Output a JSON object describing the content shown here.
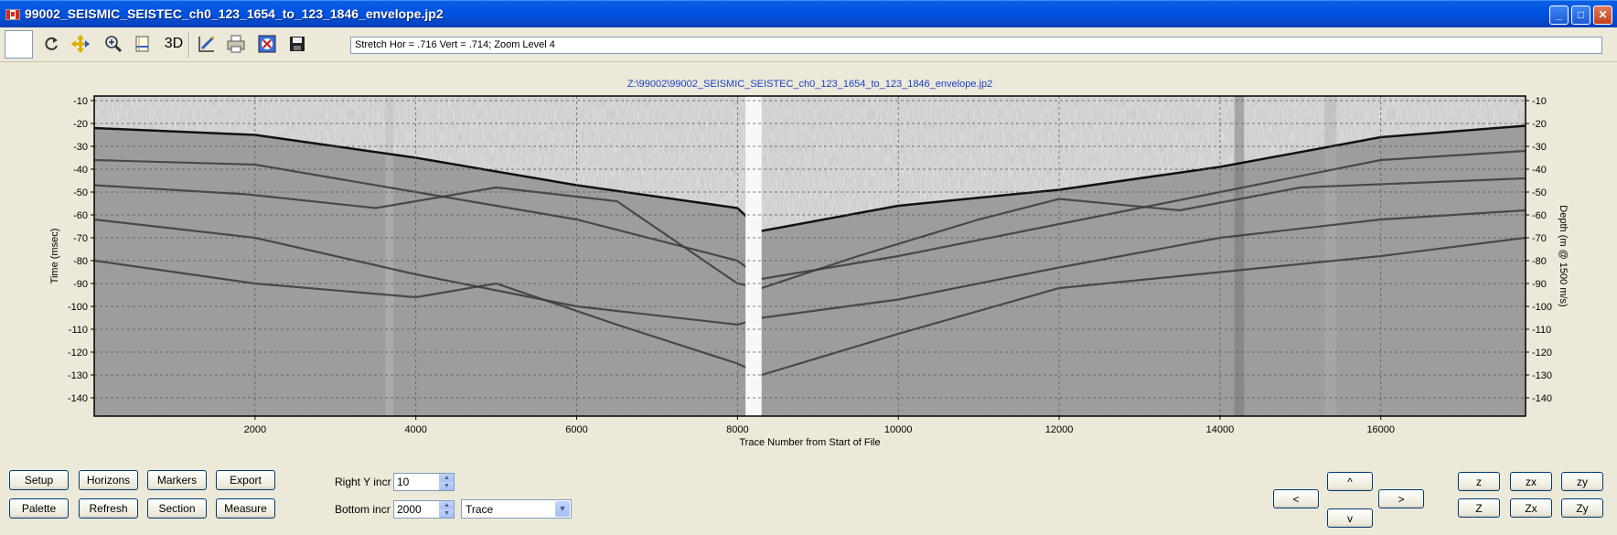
{
  "window": {
    "title": "99002_SEISMIC_SEISTEC_ch0_123_1654_to_123_1846_envelope.jp2",
    "flag_icon": "canada-flag-icon"
  },
  "toolbar": {
    "icons": [
      "refresh-icon",
      "pan-icon",
      "zoom-icon",
      "page-icon",
      "3d-icon",
      "draw-icon",
      "print-icon",
      "image-icon",
      "save-icon"
    ],
    "three_d_label": "3D",
    "status_text": "Stretch Hor = .716 Vert = .714; Zoom Level 4"
  },
  "chart_data": {
    "type": "heatmap",
    "title": "Z:\\99002\\99002_SEISMIC_SEISTEC_ch0_123_1654_to_123_1846_envelope.jp2",
    "xlabel": "Trace Number from Start of File",
    "ylabel": "Time (msec)",
    "y2label": "Depth (m @ 1500 m/s)",
    "xlim": [
      0,
      17800
    ],
    "ylim": [
      -148,
      -8
    ],
    "x_ticks": [
      2000,
      4000,
      6000,
      8000,
      10000,
      12000,
      14000,
      16000
    ],
    "y_ticks": [
      -10,
      -20,
      -30,
      -40,
      -50,
      -60,
      -70,
      -80,
      -90,
      -100,
      -110,
      -120,
      -130,
      -140
    ],
    "grid": true,
    "colormap": "grayscale",
    "seafloor_reflector": {
      "x": [
        0,
        2000,
        4000,
        6000,
        8000,
        8300,
        10000,
        12000,
        14000,
        16000,
        17800
      ],
      "y": [
        -22,
        -25,
        -35,
        -47,
        -57,
        -67,
        -56,
        -49,
        -39,
        -26,
        -21
      ]
    },
    "reflectors": [
      {
        "x": [
          0,
          2000,
          4000,
          6000,
          8000,
          8300,
          10000,
          12000,
          14000,
          16000,
          17800
        ],
        "y": [
          -36,
          -38,
          -50,
          -62,
          -80,
          -88,
          -78,
          -64,
          -50,
          -36,
          -32
        ]
      },
      {
        "x": [
          0,
          1900,
          3500,
          5000,
          6500,
          7500,
          8000,
          8300,
          9500,
          11000,
          12000,
          13500,
          15000,
          17800
        ],
        "y": [
          -47,
          -51,
          -57,
          -48,
          -54,
          -78,
          -90,
          -92,
          -78,
          -62,
          -53,
          -58,
          -48,
          -44
        ]
      },
      {
        "x": [
          0,
          2000,
          4000,
          6000,
          8000,
          8300,
          10000,
          12000,
          14000,
          16000,
          17800
        ],
        "y": [
          -62,
          -70,
          -86,
          -100,
          -108,
          -105,
          -97,
          -83,
          -70,
          -62,
          -58
        ]
      },
      {
        "x": [
          0,
          2000,
          4000,
          5000,
          6500,
          8000,
          8300,
          10000,
          12000,
          14000,
          16000,
          17800
        ],
        "y": [
          -80,
          -90,
          -96,
          -90,
          -108,
          -125,
          -130,
          -112,
          -92,
          -85,
          -78,
          -70
        ]
      }
    ],
    "gap_trace_range": [
      8100,
      8300
    ]
  },
  "controls": {
    "buttons_row1": [
      "Setup",
      "Horizons",
      "Markers",
      "Export"
    ],
    "buttons_row2": [
      "Palette",
      "Refresh",
      "Section",
      "Measure"
    ],
    "right_y_label": "Right Y incr",
    "right_y_value": "10",
    "bottom_label": "Bottom  incr",
    "bottom_value": "2000",
    "axis_mode": "Trace",
    "nav": {
      "up": "^",
      "left": "<",
      "right": ">",
      "down": "v"
    },
    "zoom_row1": [
      "z",
      "zx",
      "zy"
    ],
    "zoom_row2": [
      "Z",
      "Zx",
      "Zy"
    ]
  }
}
